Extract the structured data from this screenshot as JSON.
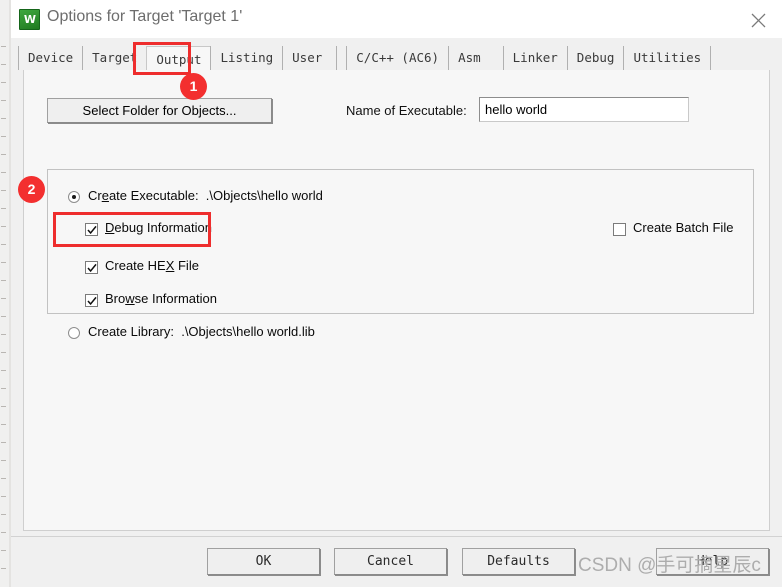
{
  "window": {
    "title": "Options for Target 'Target 1'",
    "icon": "uvision-logo-icon",
    "close_label": "close-icon"
  },
  "tabs": [
    {
      "label": "Device",
      "selected": false
    },
    {
      "label": "Target",
      "selected": false
    },
    {
      "label": "Output",
      "selected": true
    },
    {
      "label": "Listing",
      "selected": false
    },
    {
      "label": "User",
      "selected": false
    },
    {
      "label": "C/C++ (AC6)",
      "selected": false
    },
    {
      "label": "Asm",
      "selected": false
    },
    {
      "label": "Linker",
      "selected": false
    },
    {
      "label": "Debug",
      "selected": false
    },
    {
      "label": "Utilities",
      "selected": false
    }
  ],
  "output_page": {
    "select_folder_button": "Select Folder for Objects...",
    "name_of_executable_label": "Name of Executable:",
    "name_of_executable_value": "hello world",
    "name_of_executable_placeholder": "",
    "create_executable": {
      "label": "Create Executable:",
      "path": ".\\Objects\\hello world",
      "selected": true
    },
    "debug_information": {
      "label": "Debug Information",
      "checked": true
    },
    "create_hex_file": {
      "label": "Create HEX File",
      "checked": true
    },
    "browse_information": {
      "label": "Browse Information",
      "checked": true
    },
    "create_batch_file": {
      "label": "Create Batch File",
      "checked": false
    },
    "create_library": {
      "label": "Create Library:",
      "path": ".\\Objects\\hello world.lib",
      "selected": false
    }
  },
  "footer": {
    "ok": "OK",
    "cancel": "Cancel",
    "defaults": "Defaults",
    "help": "Help"
  },
  "annotations": {
    "badge_1": "1",
    "badge_2": "2",
    "color": "#f32f2f"
  },
  "watermark": "CSDN @手可摘星辰c"
}
